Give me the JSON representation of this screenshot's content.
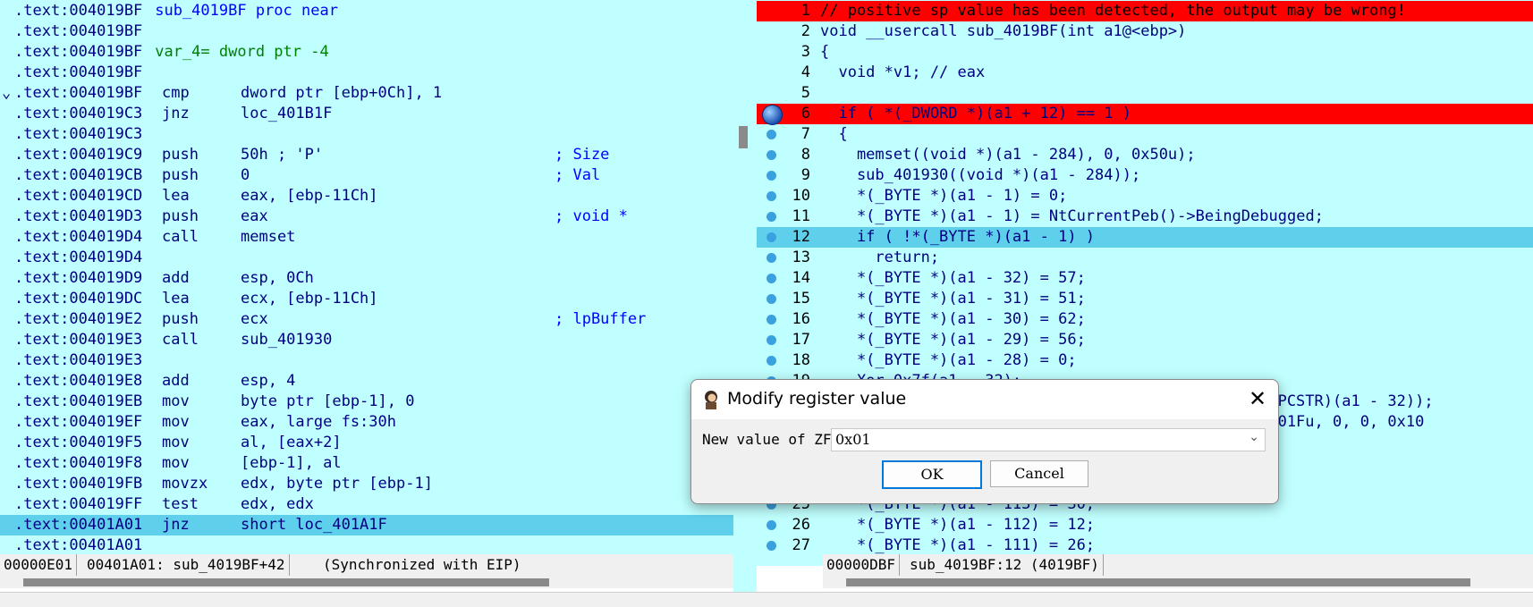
{
  "disasm": {
    "lines": [
      {
        "addr": ".text:004019BF",
        "rest": " sub_4019BF proc near",
        "type": "proc"
      },
      {
        "addr": ".text:004019BF",
        "rest": "",
        "type": "blank"
      },
      {
        "addr": ".text:004019BF",
        "rest": " var_4= dword ptr -4",
        "type": "var"
      },
      {
        "addr": ".text:004019BF",
        "rest": "",
        "type": "blank"
      },
      {
        "addr": ".text:004019BF",
        "mn": "cmp",
        "op": "dword ptr [ebp+0Ch], 1",
        "fold": true
      },
      {
        "addr": ".text:004019C3",
        "mn": "jnz",
        "op": "loc_401B1F"
      },
      {
        "addr": ".text:004019C3",
        "rest": "",
        "type": "blank"
      },
      {
        "addr": ".text:004019C9",
        "mn": "push",
        "op": "50h ; 'P'",
        "cmt": "; Size"
      },
      {
        "addr": ".text:004019CB",
        "mn": "push",
        "op": "0",
        "cmt": "; Val"
      },
      {
        "addr": ".text:004019CD",
        "mn": "lea",
        "op": "eax, [ebp-11Ch]"
      },
      {
        "addr": ".text:004019D3",
        "mn": "push",
        "op": "eax",
        "cmt": "; void *"
      },
      {
        "addr": ".text:004019D4",
        "mn": "call",
        "op": "memset"
      },
      {
        "addr": ".text:004019D4",
        "rest": "",
        "type": "blank"
      },
      {
        "addr": ".text:004019D9",
        "mn": "add",
        "op": "esp, 0Ch"
      },
      {
        "addr": ".text:004019DC",
        "mn": "lea",
        "op": "ecx, [ebp-11Ch]"
      },
      {
        "addr": ".text:004019E2",
        "mn": "push",
        "op": "ecx",
        "cmt": "; lpBuffer"
      },
      {
        "addr": ".text:004019E3",
        "mn": "call",
        "op": "sub_401930"
      },
      {
        "addr": ".text:004019E3",
        "rest": "",
        "type": "blank"
      },
      {
        "addr": ".text:004019E8",
        "mn": "add",
        "op": "esp, 4"
      },
      {
        "addr": ".text:004019EB",
        "mn": "mov",
        "op": "byte ptr [ebp-1], 0"
      },
      {
        "addr": ".text:004019EF",
        "mn": "mov",
        "op": "eax, large fs:30h"
      },
      {
        "addr": ".text:004019F5",
        "mn": "mov",
        "op": "al, [eax+2]"
      },
      {
        "addr": ".text:004019F8",
        "mn": "mov",
        "op": "[ebp-1], al"
      },
      {
        "addr": ".text:004019FB",
        "mn": "movzx",
        "op": "edx, byte ptr [ebp-1]"
      },
      {
        "addr": ".text:004019FF",
        "mn": "test",
        "op": "edx, edx"
      },
      {
        "addr": ".text:00401A01",
        "mn": "jnz",
        "op": "short loc_401A1F",
        "current": true
      },
      {
        "addr": ".text:00401A01",
        "rest": "",
        "type": "blank"
      }
    ],
    "status": {
      "offset": "00000E01",
      "location": "00401A01: sub_4019BF+42",
      "sync": "(Synchronized with EIP)"
    }
  },
  "pseudocode": {
    "lines": [
      {
        "n": "1",
        "text": "// positive sp value has been detected, the output may be wrong!",
        "hl": "red"
      },
      {
        "n": "2",
        "text": "void __usercall sub_4019BF(int a1@<ebp>)"
      },
      {
        "n": "3",
        "text": "{"
      },
      {
        "n": "4",
        "text": "  void *v1; // eax"
      },
      {
        "n": "5",
        "text": ""
      },
      {
        "n": "6",
        "text": "  if ( *(_DWORD *)(a1 + 12) == 1 )",
        "hl": "red",
        "bp": "big"
      },
      {
        "n": "7",
        "text": "  {",
        "bp": "dot"
      },
      {
        "n": "8",
        "text": "    memset((void *)(a1 - 284), 0, 0x50u);",
        "bp": "dot"
      },
      {
        "n": "9",
        "text": "    sub_401930((void *)(a1 - 284));",
        "bp": "dot"
      },
      {
        "n": "10",
        "text": "    *(_BYTE *)(a1 - 1) = 0;",
        "bp": "dot"
      },
      {
        "n": "11",
        "text": "    *(_BYTE *)(a1 - 1) = NtCurrentPeb()->BeingDebugged;",
        "bp": "dot"
      },
      {
        "n": "12",
        "text": "    if ( !*(_BYTE *)(a1 - 1) )",
        "hl": "cyan",
        "bp": "dot"
      },
      {
        "n": "13",
        "text": "      return;",
        "bp": "dot"
      },
      {
        "n": "14",
        "text": "    *(_BYTE *)(a1 - 32) = 57;",
        "bp": "dot"
      },
      {
        "n": "15",
        "text": "    *(_BYTE *)(a1 - 31) = 51;",
        "bp": "dot"
      },
      {
        "n": "16",
        "text": "    *(_BYTE *)(a1 - 30) = 62;",
        "bp": "dot"
      },
      {
        "n": "17",
        "text": "    *(_BYTE *)(a1 - 29) = 56;",
        "bp": "dot"
      },
      {
        "n": "18",
        "text": "    *(_BYTE *)(a1 - 28) = 0;",
        "bp": "dot"
      },
      {
        "n": "19",
        "text": "    Xor_0x7f(a1 - 32);",
        "bp": "dot"
      },
      {
        "n": "20",
        "text": "0x1000u, (LPCSTR)(a1 - 32));",
        "partial": true
      },
      {
        "n": "21",
        "text": "bject, 0xF001Fu, 0, 0, 0x10",
        "partial": true
      },
      {
        "n": "22",
        "text": ""
      },
      {
        "n": "23",
        "text": ""
      },
      {
        "n": "24",
        "text": ""
      },
      {
        "n": "25",
        "text": "    *(_BYTE *)(a1 - 113) = 30;",
        "bp": "dot"
      },
      {
        "n": "26",
        "text": "    *(_BYTE *)(a1 - 112) = 12;",
        "bp": "dot"
      },
      {
        "n": "27",
        "text": "    *(_BYTE *)(a1 - 111) = 26;",
        "bp": "dot"
      }
    ],
    "status": {
      "offset": "00000DBF",
      "location": "sub_4019BF:12 (4019BF)"
    }
  },
  "dialog": {
    "title": "Modify register value",
    "label": "New value of ZF",
    "value": "0x01",
    "ok": "OK",
    "cancel": "Cancel",
    "close": "✕"
  },
  "colors": {
    "background": "#c0ffff",
    "highlight_cyan": "#5fd0ec",
    "highlight_red": "#ff0000"
  }
}
